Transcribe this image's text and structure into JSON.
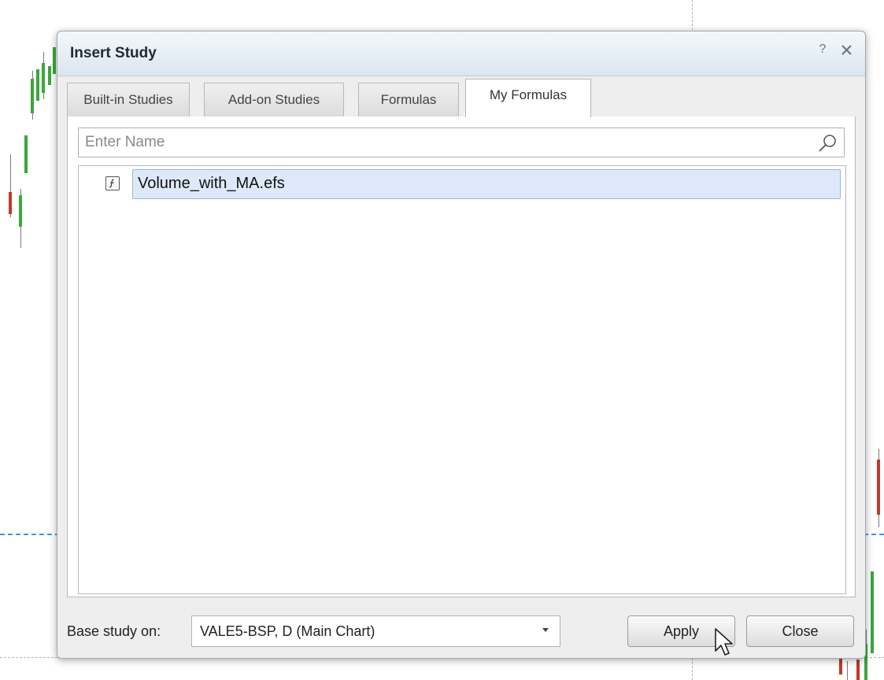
{
  "dialog": {
    "title": "Insert Study",
    "help_label": "?",
    "close_label": "✕"
  },
  "tabs": [
    {
      "label": "Built-in Studies",
      "active": false
    },
    {
      "label": "Add-on Studies",
      "active": false
    },
    {
      "label": "Formulas",
      "active": false
    },
    {
      "label": "My Formulas",
      "active": true
    }
  ],
  "search": {
    "placeholder": "Enter Name",
    "value": ""
  },
  "list": {
    "items": [
      {
        "label": "Volume_with_MA.efs",
        "icon": "formula-file-icon",
        "selected": true
      }
    ]
  },
  "footer": {
    "base_label": "Base study on:",
    "base_value": "VALE5-BSP, D (Main Chart)",
    "apply_label": "Apply",
    "close_label": "Close"
  },
  "colors": {
    "candle_up": "#3aa83a",
    "candle_down": "#c0392b",
    "selection_bg": "#dde9f8",
    "guide_line": "#4a90e2"
  }
}
